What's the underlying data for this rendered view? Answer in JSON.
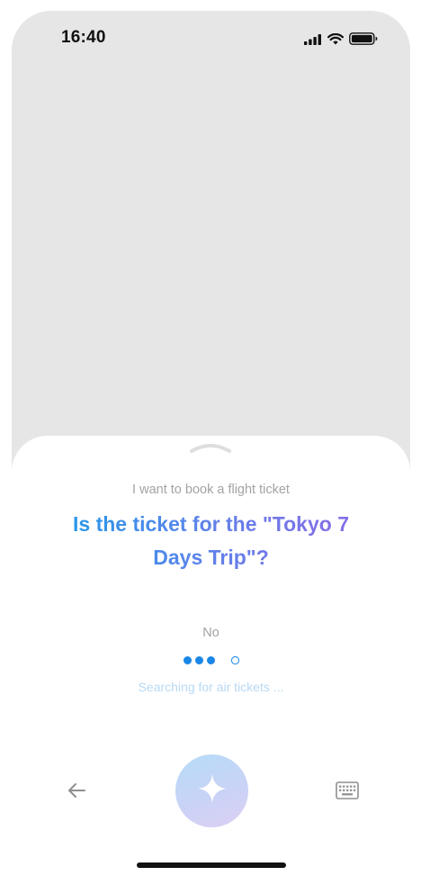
{
  "status_bar": {
    "time": "16:40",
    "icons": [
      "cellular-signal-icon",
      "wifi-icon",
      "battery-icon"
    ]
  },
  "sheet": {
    "prompt": "I want to book a flight ticket",
    "question": "Is the ticket for the \"Tokyo 7 Days Trip\"?",
    "answer": "No",
    "status": "Searching for air tickets ...",
    "progress": {
      "filled_dots": 3,
      "total_dots": 4
    }
  },
  "controls": {
    "left_icon": "arrow-left-icon",
    "center_icon": "sparkle-icon",
    "right_icon": "keyboard-icon"
  },
  "colors": {
    "accent_blue": "#1a86e6",
    "gradient_start": "#1e9be8",
    "gradient_end": "#8f6ae6",
    "muted_text": "#a3a3a3",
    "status_text": "#b7d9f5",
    "background_gray": "#e6e6e6"
  }
}
